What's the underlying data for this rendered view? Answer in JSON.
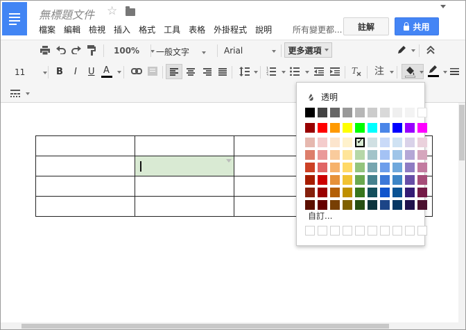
{
  "doc": {
    "title": "無標題文件",
    "save_status": "所有變更都..."
  },
  "menu": [
    "檔案",
    "編輯",
    "檢視",
    "插入",
    "格式",
    "工具",
    "表格",
    "外掛程式",
    "說明"
  ],
  "buttons": {
    "comment": "註解",
    "share": "共用"
  },
  "toolbar": {
    "zoom": "100%",
    "style": "一般文字",
    "font": "Arial",
    "more": "更多選項",
    "font_size": "11",
    "bold": "B",
    "italic": "I",
    "underline": "U",
    "text_color": "A",
    "line_spacing_icon": "line-spacing-icon",
    "comment_icon": "注"
  },
  "color_picker": {
    "transparent_label": "透明",
    "custom_label": "自訂...",
    "rows": [
      [
        "#000000",
        "#434343",
        "#666666",
        "#999999",
        "#b7b7b7",
        "#cccccc",
        "#d9d9d9",
        "#efefef",
        "#f3f3f3",
        "#ffffff"
      ],
      [
        "#980000",
        "#ff0000",
        "#ff9900",
        "#ffff00",
        "#00ff00",
        "#00ffff",
        "#4a86e8",
        "#0000ff",
        "#9900ff",
        "#ff00ff"
      ],
      [
        "#e6b8af",
        "#f4cccc",
        "#fce5cd",
        "#fff2cc",
        "#d9ead3",
        "#d0e0e3",
        "#c9daf8",
        "#cfe2f3",
        "#d9d2e9",
        "#ead1dc"
      ],
      [
        "#dd7e6b",
        "#ea9999",
        "#f9cb9c",
        "#ffe599",
        "#b6d7a8",
        "#a2c4c9",
        "#a4c2f4",
        "#9fc5e8",
        "#b4a7d6",
        "#d5a6bd"
      ],
      [
        "#cc4125",
        "#e06666",
        "#f6b26b",
        "#ffd966",
        "#93c47d",
        "#76a5af",
        "#6d9eeb",
        "#6fa8dc",
        "#8e7cc3",
        "#c27ba0"
      ],
      [
        "#a61c00",
        "#cc0000",
        "#e69138",
        "#f1c232",
        "#6aa84f",
        "#45818e",
        "#3c78d8",
        "#3d85c6",
        "#674ea7",
        "#a64d79"
      ],
      [
        "#85200c",
        "#990000",
        "#b45f06",
        "#bf9000",
        "#38761d",
        "#134f5c",
        "#1155cc",
        "#0b5394",
        "#351c75",
        "#741b47"
      ],
      [
        "#5b0f00",
        "#660000",
        "#783f04",
        "#7f6000",
        "#274e13",
        "#0c343d",
        "#1c4587",
        "#073763",
        "#20124d",
        "#4c1130"
      ]
    ],
    "selected_color": "#d9ead3",
    "check_mark": "✓"
  },
  "table": {
    "rows": 4,
    "cols": 4,
    "selected_cell_color": "#d9ead3"
  }
}
